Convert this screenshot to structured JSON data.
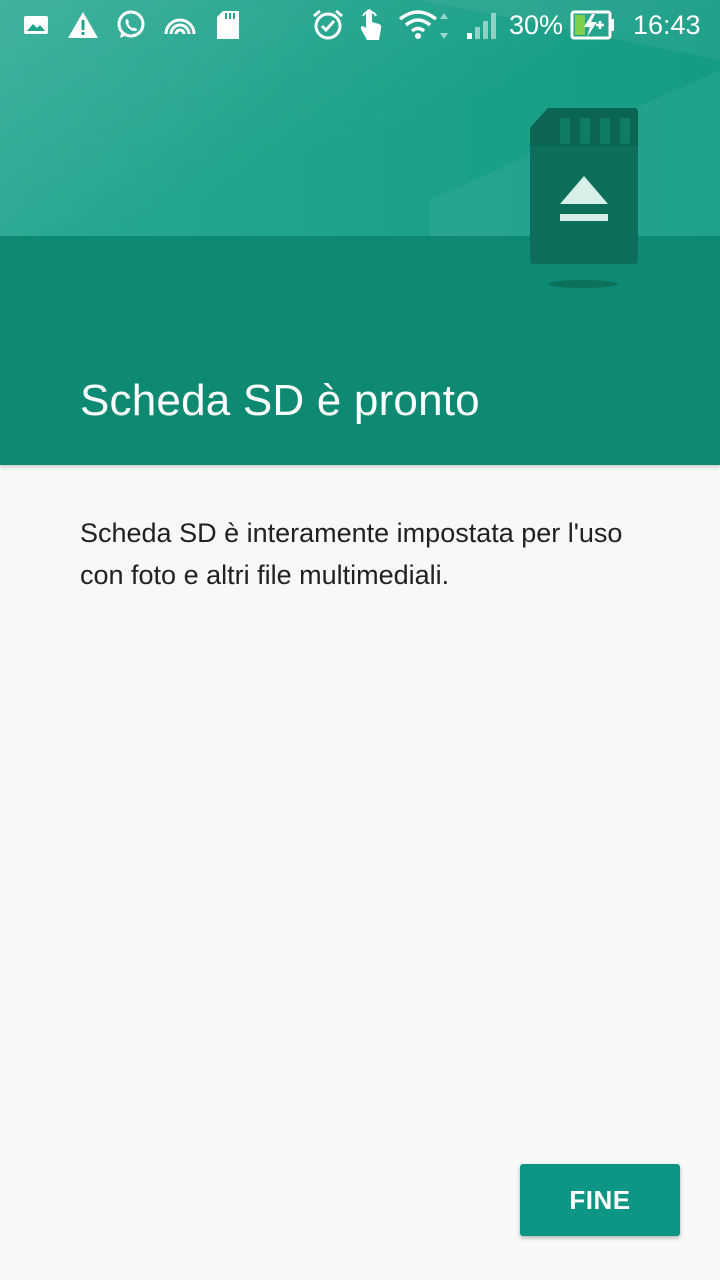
{
  "status_bar": {
    "icons_left": [
      "image-icon",
      "warning-icon",
      "whatsapp-icon",
      "hotspot-icon",
      "sd-card-icon"
    ],
    "icons_right": [
      "alarm-icon",
      "touch-icon",
      "wifi-icon",
      "signal-icon",
      "battery-charging-icon"
    ],
    "battery_percent": "30%",
    "time": "16:43"
  },
  "header": {
    "title": "Scheda SD è pronto",
    "illustration": "sd-card-eject-icon"
  },
  "content": {
    "message": "Scheda SD è interamente impostata per l'uso con foto e altri file multimediali."
  },
  "actions": {
    "done_label": "FINE"
  },
  "colors": {
    "header_dark": "#0e8a72",
    "header_light": "#2aa992",
    "button": "#0c9683",
    "background": "#f8f8f8",
    "text": "#212121"
  }
}
